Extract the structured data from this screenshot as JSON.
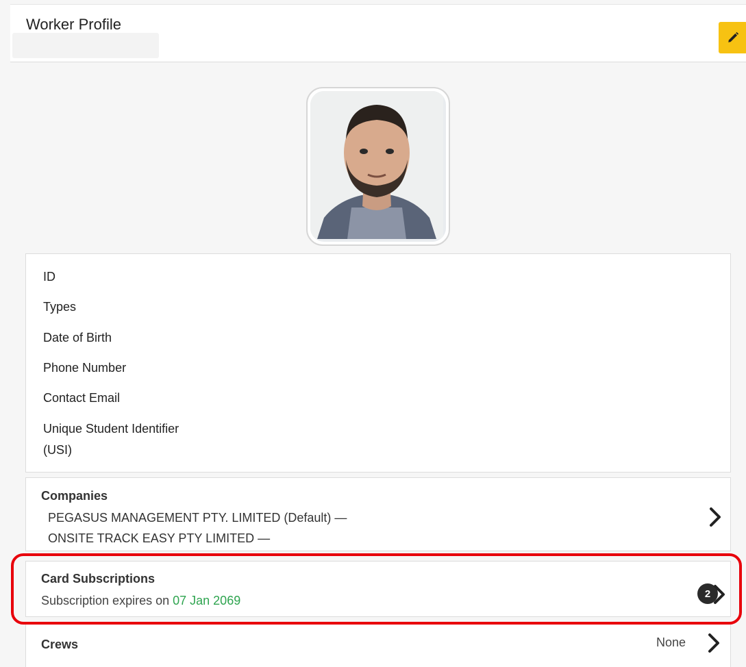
{
  "header": {
    "title": "Worker Profile"
  },
  "icons": {
    "edit": "pencil-icon",
    "chevron": "chevron-right-icon"
  },
  "colors": {
    "accent": "#f7c212",
    "expiry_date": "#2ea44f",
    "highlight": "#e8000b"
  },
  "profile": {
    "fields": {
      "id": "ID",
      "types": "Types",
      "dob": "Date of Birth",
      "phone": "Phone Number",
      "email": "Contact Email",
      "usi_line1": "Unique Student Identifier",
      "usi_line2": "(USI)"
    }
  },
  "companies": {
    "title": "Companies",
    "items": [
      "PEGASUS MANAGEMENT PTY. LIMITED (Default) —",
      "ONSITE TRACK EASY PTY LIMITED —"
    ]
  },
  "card_subscriptions": {
    "title": "Card Subscriptions",
    "count": "2",
    "expiry_prefix": "Subscription expires on",
    "expiry_date": "07 Jan 2069"
  },
  "crews": {
    "title": "Crews",
    "value": "None"
  }
}
